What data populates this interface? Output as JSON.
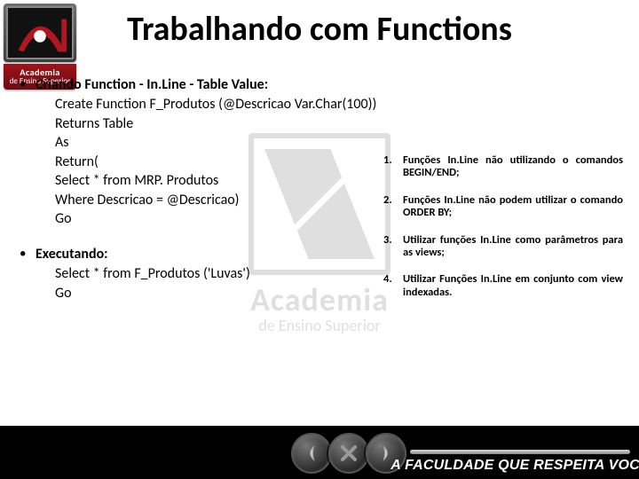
{
  "logo": {
    "name": "Academia",
    "subtitle": "de Ensino Superior"
  },
  "watermark": {
    "line1": "Academia",
    "line2": "de Ensino Superior"
  },
  "title": "Trabalhando com Functions",
  "section1": {
    "heading": "Criando Function - In.Line - Table Value:",
    "lines": [
      "Create Function F_Produtos (@Descricao Var.Char(100))",
      "Returns Table",
      "As",
      "Return(",
      "Select * from MRP. Produtos",
      "Where Descricao = @Descricao)",
      "Go"
    ]
  },
  "section2": {
    "heading": "Executando:",
    "lines": [
      "Select * from F_Produtos ('Luvas')",
      "Go"
    ]
  },
  "notes": [
    {
      "n": "1.",
      "t": "Funções In.Line não utilizando o comandos BEGIN/END;"
    },
    {
      "n": "2.",
      "t": "Funções In.Line não podem utilizar o comando ORDER BY;"
    },
    {
      "n": "3.",
      "t": "Utilizar funções In.Line como parâmetros para as views;"
    },
    {
      "n": "4.",
      "t": "Utilizar Funções In.Line em conjunto com view indexadas."
    }
  ],
  "footer": {
    "slogan": "A FACULDADE QUE RESPEITA VOCÊ"
  }
}
